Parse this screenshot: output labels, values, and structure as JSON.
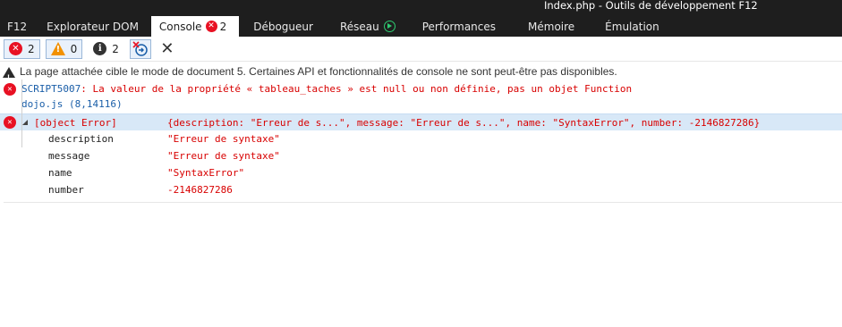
{
  "window": {
    "title": "Index.php - Outils de développement F12"
  },
  "tabs": [
    {
      "label": "F12"
    },
    {
      "label": "Explorateur DOM"
    },
    {
      "label": "Console",
      "error_count": "2"
    },
    {
      "label": "Débogueur"
    },
    {
      "label": "Réseau"
    },
    {
      "label": "Performances"
    },
    {
      "label": "Mémoire"
    },
    {
      "label": "Émulation"
    }
  ],
  "toolbar": {
    "errors": {
      "icon": "error-icon",
      "count": "2"
    },
    "warnings": {
      "icon": "warning-icon",
      "count": "0"
    },
    "messages": {
      "icon": "info-icon",
      "count": "2"
    },
    "target_icon": "clear-on-navigate-icon",
    "clear_icon": "clear-console-icon"
  },
  "console": {
    "warning": "La page attachée cible le mode de document 5. Certaines API et fonctionnalités de console ne sont peut-être pas disponibles.",
    "script_error": {
      "code": "SCRIPT5007",
      "message": ": La valeur de la propriété « tableau_taches » est null ou non définie, pas un objet Function",
      "source": "dojo.js (8,14116)"
    },
    "object_error": {
      "label": "[object Error]",
      "summary": "{description: \"Erreur de s...\", message: \"Erreur de s...\", name: \"SyntaxError\", number: -2146827286}",
      "properties": [
        {
          "key": "description",
          "value": "\"Erreur de syntaxe\""
        },
        {
          "key": "message",
          "value": "\"Erreur de syntaxe\""
        },
        {
          "key": "name",
          "value": "\"SyntaxError\""
        },
        {
          "key": "number",
          "value": "-2146827286"
        }
      ]
    }
  },
  "colors": {
    "error": "#e81123",
    "error_text": "#d80000",
    "link": "#1a5ea8",
    "selection": "#d8e8f7",
    "titlebar": "#1e1e1e"
  }
}
